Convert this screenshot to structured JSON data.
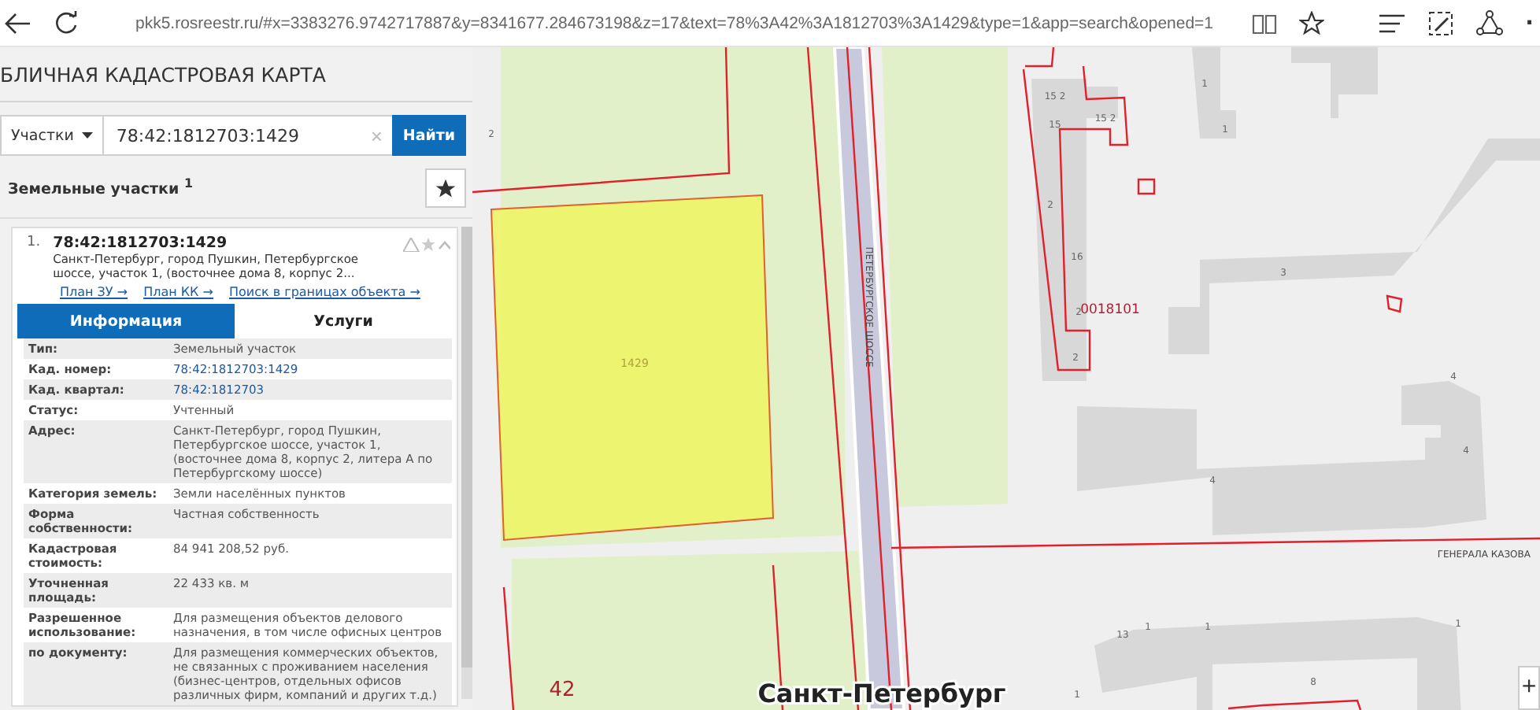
{
  "browser": {
    "url": "pkk5.rosreestr.ru/#x=3383276.9742717887&y=8341677.284673198&z=17&text=78%3A42%3A1812703%3A1429&type=1&app=search&opened=1",
    "more": "·"
  },
  "app": {
    "title": "БЛИЧНАЯ КАДАСТРОВАЯ КАРТА"
  },
  "search": {
    "category": "Участки",
    "value": "78:42:1812703:1429",
    "clear": "×",
    "button": "Найти"
  },
  "results": {
    "heading": "Земельные участки $^{1}$"
  },
  "result": {
    "index": "1.",
    "number": "78:42:1812703:1429",
    "address": "Санкт-Петербург, город Пушкин, Петербургское шоссе, участок 1, (восточнее дома 8, корпус 2...",
    "links": [
      "План ЗУ →",
      "План КК →",
      "Поиск в границах объекта →"
    ],
    "tabs": [
      {
        "label": "Информация",
        "selected": true
      },
      {
        "label": "Услуги",
        "selected": false
      }
    ],
    "rows": [
      {
        "label": "Тип:",
        "value": "Земельный участок",
        "kind": "text"
      },
      {
        "label": "Кад. номер:",
        "value": "78:42:1812703:1429",
        "kind": "link"
      },
      {
        "label": "Кад. квартал:",
        "value": "78:42:1812703",
        "kind": "link"
      },
      {
        "label": "Статус:",
        "value": "Учтенный",
        "kind": "text"
      },
      {
        "label": "Адрес:",
        "value": "Санкт-Петербург, город Пушкин, Петербургское шоссе, участок 1, (восточнее дома 8, корпус 2, литера А по Петербургскому шоссе)",
        "kind": "text"
      },
      {
        "label": "Категория земель:",
        "value": "Земли населённых пунктов",
        "kind": "text"
      },
      {
        "label": "Форма собственности:",
        "value": "Частная собственность",
        "kind": "text"
      },
      {
        "label": "Кадастровая стоимость:",
        "value": "84 941 208,52 руб.",
        "kind": "text"
      },
      {
        "label": "Уточненная площадь:",
        "value": "22 433 кв. м",
        "kind": "text"
      },
      {
        "label": "Разрешенное использование:",
        "value": "Для размещения объектов делового назначения, в том числе офисных центров",
        "kind": "text"
      },
      {
        "label": "по документу:",
        "value": "Для размещения коммерческих объектов, не связанных с проживанием населения (бизнес-центров, отдельных офисов различных фирм, компаний и других т.д.)",
        "kind": "text"
      }
    ]
  },
  "map": {
    "labels": [
      {
        "text": "2",
        "kind": "number"
      },
      {
        "text": "1429",
        "kind": "parcel"
      },
      {
        "text": "ПЕТЕРБУРГСКОЕ ШОССЕ",
        "kind": "street-vertical"
      },
      {
        "text": "42",
        "kind": "block"
      },
      {
        "text": "15 2",
        "kind": "number"
      },
      {
        "text": "15 2",
        "kind": "number"
      },
      {
        "text": "15",
        "kind": "number"
      },
      {
        "text": "2",
        "kind": "number"
      },
      {
        "text": "16",
        "kind": "number"
      },
      {
        "text": "2",
        "kind": "number"
      },
      {
        "text": "2",
        "kind": "number"
      },
      {
        "text": "1",
        "kind": "number"
      },
      {
        "text": "1",
        "kind": "number"
      },
      {
        "text": "3",
        "kind": "number"
      },
      {
        "text": "0018101",
        "kind": "quarter"
      },
      {
        "text": "4",
        "kind": "number"
      },
      {
        "text": "4",
        "kind": "number"
      },
      {
        "text": "4",
        "kind": "number"
      },
      {
        "text": "ГЕНЕРАЛА КАЗОВА",
        "kind": "street"
      },
      {
        "text": "13",
        "kind": "number"
      },
      {
        "text": "1",
        "kind": "number"
      },
      {
        "text": "1",
        "kind": "number"
      },
      {
        "text": "1",
        "kind": "number"
      },
      {
        "text": "8",
        "kind": "number"
      },
      {
        "text": "1",
        "kind": "number"
      }
    ],
    "city": "Санкт-Петербург",
    "zoom_in": "+"
  }
}
